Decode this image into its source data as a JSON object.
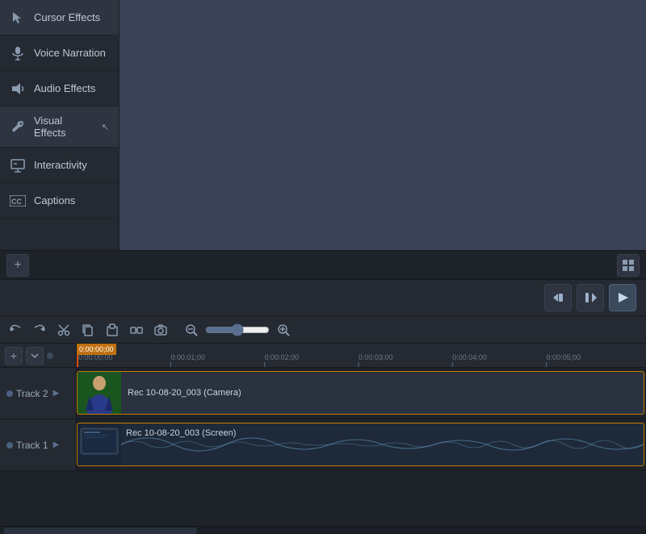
{
  "sidebar": {
    "items": [
      {
        "id": "cursor-effects",
        "label": "Cursor Effects",
        "icon": "cursor"
      },
      {
        "id": "voice-narration",
        "label": "Voice Narration",
        "icon": "mic"
      },
      {
        "id": "audio-effects",
        "label": "Audio Effects",
        "icon": "speaker"
      },
      {
        "id": "visual-effects",
        "label": "Visual Effects",
        "icon": "wrench",
        "active": true
      },
      {
        "id": "interactivity",
        "label": "Interactivity",
        "icon": "monitor"
      },
      {
        "id": "captions",
        "label": "Captions",
        "icon": "cc"
      }
    ]
  },
  "playback": {
    "rewind_label": "⏮",
    "play_pause_label": "⏸",
    "play_label": "▶"
  },
  "timeline": {
    "toolbar": {
      "undo": "↩",
      "redo": "↪",
      "cut": "✂",
      "copy": "⧉",
      "paste": "📋",
      "snap": "⊟",
      "camera": "📷",
      "zoom_in": "+",
      "zoom_out": "−",
      "add_track": "+"
    },
    "ruler_times": [
      "0:00:00;00",
      "0:00:01;00",
      "0:00:02;00",
      "0:00:03;00",
      "0:00:04;00",
      "0:00:05;00"
    ],
    "tracks": [
      {
        "id": "track2",
        "label": "Track 2",
        "clip": "Rec 10-08-20_003 (Camera)",
        "type": "camera"
      },
      {
        "id": "track1",
        "label": "Track 1",
        "clip": "Rec 10-08-20_003 (Screen)",
        "type": "screen"
      }
    ]
  },
  "bottom_bar": {
    "add_label": "+",
    "grid_label": "⊞"
  }
}
